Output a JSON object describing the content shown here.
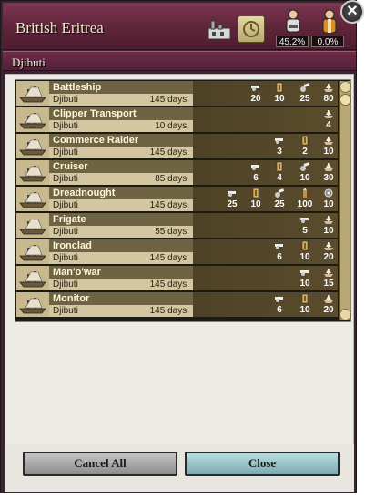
{
  "header": {
    "title": "British Eritrea",
    "worker_a_pct": "45.2%",
    "worker_b_pct": "0.0%",
    "icons": {
      "factory": "factory-icon",
      "clock": "clock-icon",
      "worker_a": "worker-icon",
      "worker_b": "officer-icon",
      "close": "close-icon"
    },
    "close_glyph": "✕"
  },
  "location": "Djibuti",
  "units": [
    {
      "name": "Battleship",
      "location": "Djibuti",
      "days": "145 days.",
      "stats": [
        {
          "icon": "gun-icon",
          "value": "20",
          "col": 2
        },
        {
          "icon": "armor-icon",
          "value": "10",
          "col": 3
        },
        {
          "icon": "cannon-icon",
          "value": "25",
          "col": 4
        },
        {
          "icon": "ship-icon",
          "value": "80",
          "col": 5
        }
      ]
    },
    {
      "name": "Clipper Transport",
      "location": "Djibuti",
      "days": "10 days.",
      "stats": [
        {
          "icon": "ship-icon",
          "value": "4",
          "col": 5
        }
      ]
    },
    {
      "name": "Commerce Raider",
      "location": "Djibuti",
      "days": "145 days.",
      "stats": [
        {
          "icon": "gun-icon",
          "value": "3",
          "col": 3
        },
        {
          "icon": "armor-icon",
          "value": "2",
          "col": 4
        },
        {
          "icon": "ship-icon",
          "value": "10",
          "col": 5
        }
      ]
    },
    {
      "name": "Cruiser",
      "location": "Djibuti",
      "days": "85 days.",
      "stats": [
        {
          "icon": "gun-icon",
          "value": "6",
          "col": 2
        },
        {
          "icon": "armor-icon",
          "value": "4",
          "col": 3
        },
        {
          "icon": "cannon-icon",
          "value": "10",
          "col": 4
        },
        {
          "icon": "ship-icon",
          "value": "30",
          "col": 5
        }
      ]
    },
    {
      "name": "Dreadnought",
      "location": "Djibuti",
      "days": "145 days.",
      "stats": [
        {
          "icon": "gun-icon",
          "value": "25",
          "col": 1
        },
        {
          "icon": "armor-icon",
          "value": "10",
          "col": 2
        },
        {
          "icon": "cannon-icon",
          "value": "25",
          "col": 3
        },
        {
          "icon": "shell-icon",
          "value": "100",
          "col": 4
        },
        {
          "icon": "tank-icon",
          "value": "10",
          "col": 5
        }
      ]
    },
    {
      "name": "Frigate",
      "location": "Djibuti",
      "days": "55 days.",
      "stats": [
        {
          "icon": "gun-icon",
          "value": "5",
          "col": 4
        },
        {
          "icon": "ship-icon",
          "value": "10",
          "col": 5
        }
      ]
    },
    {
      "name": "Ironclad",
      "location": "Djibuti",
      "days": "145 days.",
      "stats": [
        {
          "icon": "gun-icon",
          "value": "6",
          "col": 3
        },
        {
          "icon": "armor-icon",
          "value": "10",
          "col": 4
        },
        {
          "icon": "ship-icon",
          "value": "20",
          "col": 5
        }
      ]
    },
    {
      "name": "Man'o'war",
      "location": "Djibuti",
      "days": "145 days.",
      "stats": [
        {
          "icon": "gun-icon",
          "value": "10",
          "col": 4
        },
        {
          "icon": "ship-icon",
          "value": "15",
          "col": 5
        }
      ]
    },
    {
      "name": "Monitor",
      "location": "Djibuti",
      "days": "145 days.",
      "stats": [
        {
          "icon": "gun-icon",
          "value": "6",
          "col": 3
        },
        {
          "icon": "armor-icon",
          "value": "10",
          "col": 4
        },
        {
          "icon": "ship-icon",
          "value": "20",
          "col": 5
        }
      ]
    }
  ],
  "buttons": {
    "cancel_all": "Cancel All",
    "close": "Close"
  }
}
